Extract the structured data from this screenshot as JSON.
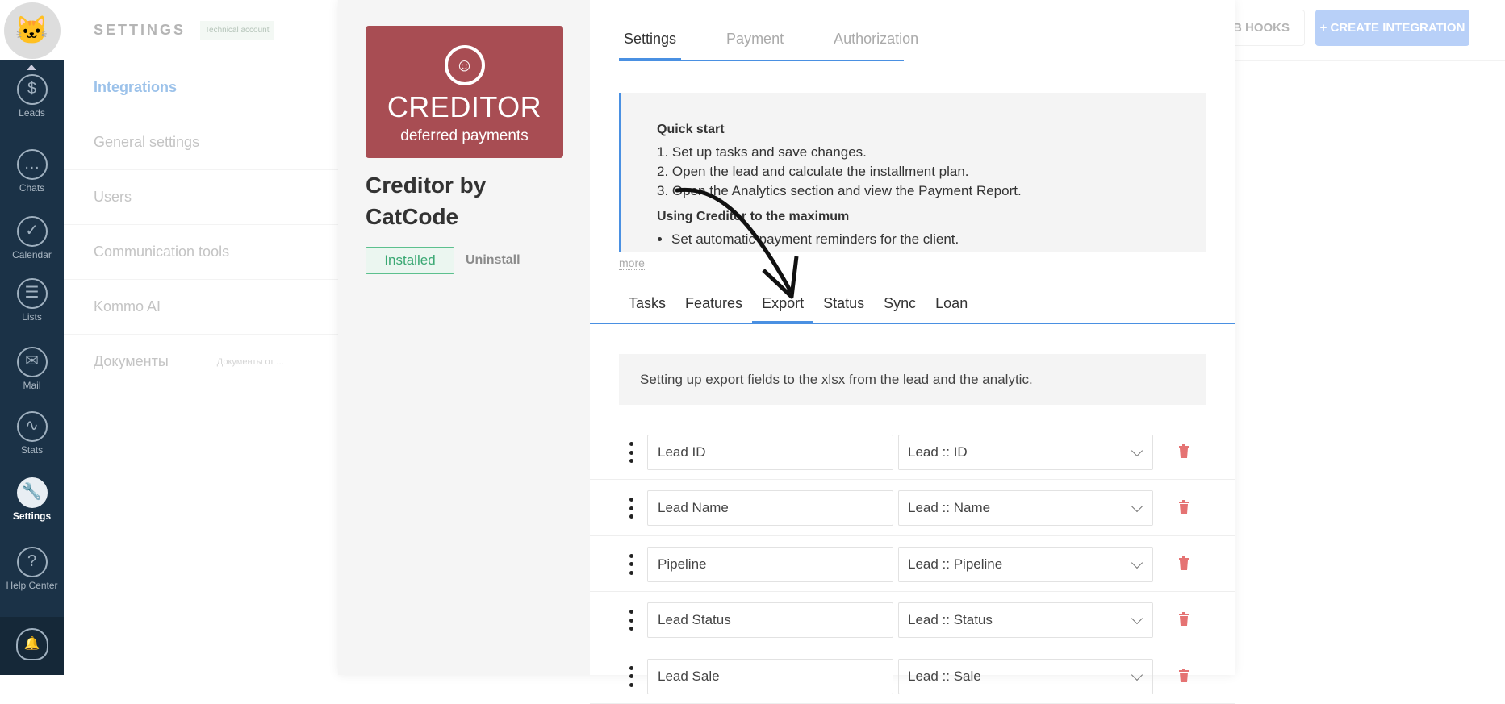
{
  "nav": {
    "items": [
      {
        "label": "Leads",
        "icon": "leads-icon",
        "glyph": "$"
      },
      {
        "label": "Chats",
        "icon": "chats-icon",
        "glyph": "…"
      },
      {
        "label": "Calendar",
        "icon": "calendar-icon",
        "glyph": "✓"
      },
      {
        "label": "Lists",
        "icon": "lists-icon",
        "glyph": "☰"
      },
      {
        "label": "Mail",
        "icon": "mail-icon",
        "glyph": "✉"
      },
      {
        "label": "Stats",
        "icon": "stats-icon",
        "glyph": "∿"
      },
      {
        "label": "Settings",
        "icon": "settings-icon",
        "glyph": "🔧"
      },
      {
        "label": "Help Center",
        "icon": "help-icon",
        "glyph": "?"
      }
    ]
  },
  "settings_panel": {
    "title": "SETTINGS",
    "badge": "Technical account",
    "items": [
      {
        "label": "Integrations"
      },
      {
        "label": "General settings"
      },
      {
        "label": "Users"
      },
      {
        "label": "Communication tools"
      },
      {
        "label": "Kommo AI"
      },
      {
        "label": "Документы",
        "sub": "Документы от ..."
      }
    ]
  },
  "header": {
    "webhooks": "WEB HOOKS",
    "create": "+ CREATE INTEGRATION"
  },
  "app": {
    "logo_name": "CREDITOR",
    "logo_tag": "deferred payments",
    "title": "Creditor by CatCode",
    "installed": "Installed",
    "uninstall": "Uninstall"
  },
  "tabs": [
    "Settings",
    "Payment",
    "Authorization"
  ],
  "info": {
    "h1": "Quick start",
    "steps": [
      "1. Set up tasks and save changes.",
      "2. Open the lead and calculate the installment plan.",
      "3. Open the Analytics section and view the Payment Report."
    ],
    "h2": "Using Creditor to the maximum",
    "bullets": [
      "Set automatic payment reminders for the client."
    ],
    "more": "more"
  },
  "subtabs": [
    "Tasks",
    "Features",
    "Export",
    "Status",
    "Sync",
    "Loan"
  ],
  "export": {
    "description": "Setting up export fields to the xlsx from the lead and the analytic.",
    "rows": [
      {
        "name": "Lead ID",
        "field": "Lead :: ID"
      },
      {
        "name": "Lead Name",
        "field": "Lead :: Name"
      },
      {
        "name": "Pipeline",
        "field": "Lead :: Pipeline"
      },
      {
        "name": "Lead Status",
        "field": "Lead :: Status"
      },
      {
        "name": "Lead Sale",
        "field": "Lead :: Sale"
      }
    ]
  },
  "colors": {
    "accent": "#4a90e2",
    "logo": "#a84d53",
    "trash": "#e57373",
    "nav": "#1b3247"
  }
}
